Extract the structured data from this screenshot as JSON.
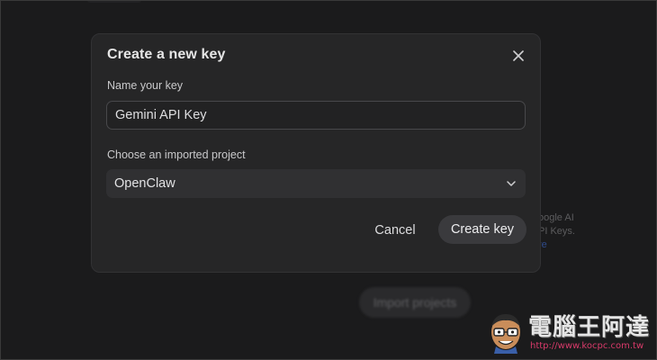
{
  "dialog": {
    "title": "Create a new key",
    "name_label": "Name your key",
    "name_value": "Gemini API Key",
    "project_label": "Choose an imported project",
    "project_selected": "OpenClaw",
    "cancel_label": "Cancel",
    "create_label": "Create key",
    "close_icon": "close-icon",
    "chevron_icon": "chevron-down-icon"
  },
  "background": {
    "side_text_line1": "oogle AI",
    "side_text_line2": "PI Keys.",
    "side_text_line3": "re",
    "import_button_label": "Import projects"
  },
  "watermark": {
    "title": "電腦王阿達",
    "url": "http://www.kocpc.com.tw"
  },
  "colors": {
    "background": "#1b1b1c",
    "dialog": "#262627",
    "input_border": "#48484b",
    "select_bg": "#303032",
    "primary_button": "#3a3a3d",
    "watermark_url": "#d83a6a"
  }
}
